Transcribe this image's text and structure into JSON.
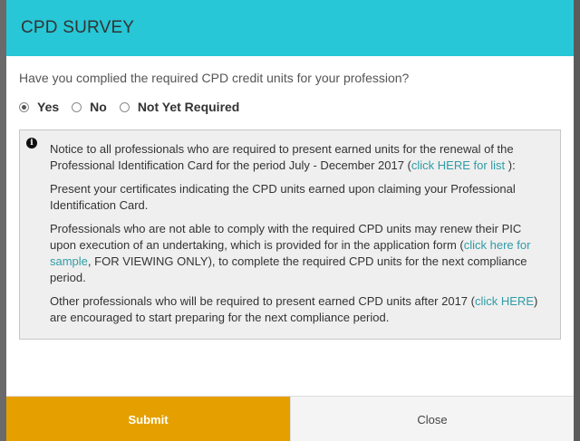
{
  "survey": {
    "title": "CPD SURVEY",
    "question": "Have you complied the required CPD credit units for your profession?",
    "options": [
      {
        "label": "Yes",
        "checked": true
      },
      {
        "label": "No",
        "checked": false
      },
      {
        "label": "Not Yet Required",
        "checked": false
      }
    ]
  },
  "notice": {
    "icon": "info-icon",
    "p1_text": "Notice to all professionals who are required to present earned units for the renewal of the Professional Identification Card for the period July - December 2017 (",
    "p1_link": "click HERE for list",
    "p1_end": " ):",
    "p2": "Present your certificates indicating the CPD units earned upon claiming your Professional Identification Card.",
    "p3_text": "Professionals who are not able to comply with the required CPD units may renew their PIC upon execution of an undertaking, which is provided for in the application form (",
    "p3_link": "click here for sample",
    "p3_end": ", FOR VIEWING ONLY), to complete the required CPD units for the next compliance period.",
    "p4_text": "Other professionals who will be required to present earned CPD units after 2017 (",
    "p4_link": "click HERE",
    "p4_end": ") are encouraged to start preparing for the next compliance period."
  },
  "footer": {
    "submit_label": "Submit",
    "close_label": "Close"
  },
  "colors": {
    "header": "#27c7d7",
    "submit": "#e5a000",
    "link": "#2f9ca6"
  }
}
